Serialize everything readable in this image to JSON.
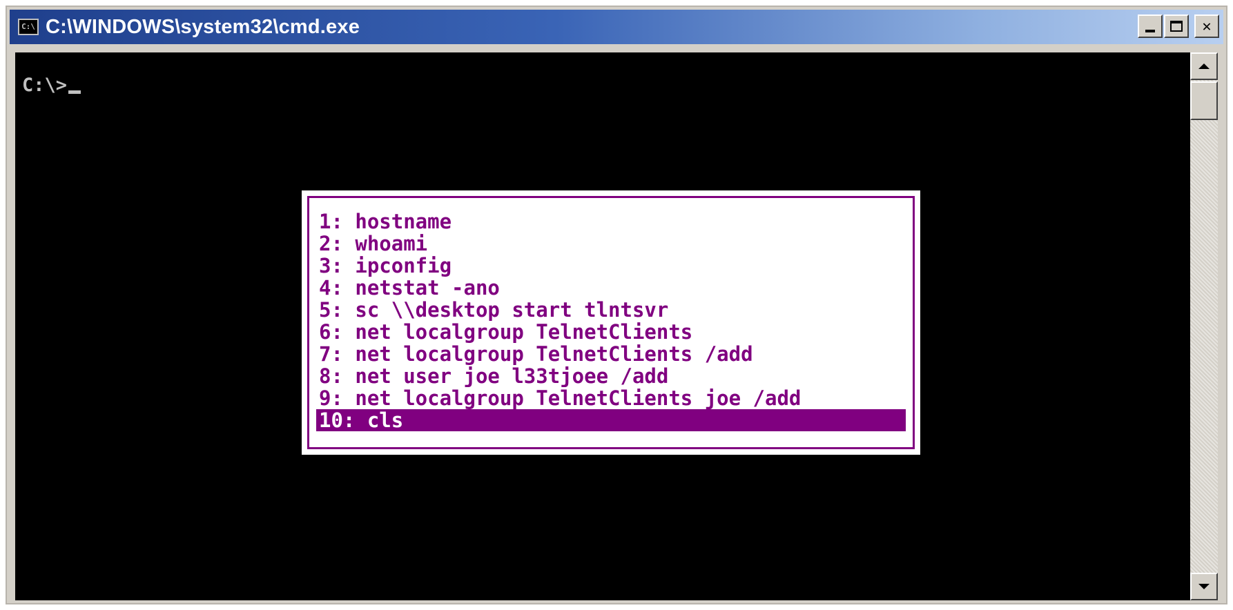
{
  "window": {
    "title": "C:\\WINDOWS\\system32\\cmd.exe",
    "icon_text": "C:\\",
    "icon": "cmd-icon"
  },
  "controls": {
    "minimize_icon": "minimize-icon",
    "maximize_icon": "maximize-icon",
    "close_label": "✕"
  },
  "console": {
    "prompt": "C:\\>",
    "colors": {
      "background": "#000000",
      "text": "#c0c0c0",
      "popup_text": "#800080",
      "popup_background": "#ffffff"
    }
  },
  "history_popup": {
    "items": [
      {
        "label": "1: hostname"
      },
      {
        "label": "2: whoami"
      },
      {
        "label": "3: ipconfig"
      },
      {
        "label": "4: netstat -ano"
      },
      {
        "label": "5: sc \\\\desktop start tlntsvr"
      },
      {
        "label": "6: net localgroup TelnetClients"
      },
      {
        "label": "7: net localgroup TelnetClients /add"
      },
      {
        "label": "8: net user joe l33tjoee /add"
      },
      {
        "label": "9: net localgroup TelnetClients joe /add"
      },
      {
        "label": "10: cls"
      }
    ],
    "selected_index": 9
  },
  "scrollbar": {
    "up_icon": "scroll-up-icon",
    "down_icon": "scroll-down-icon"
  }
}
